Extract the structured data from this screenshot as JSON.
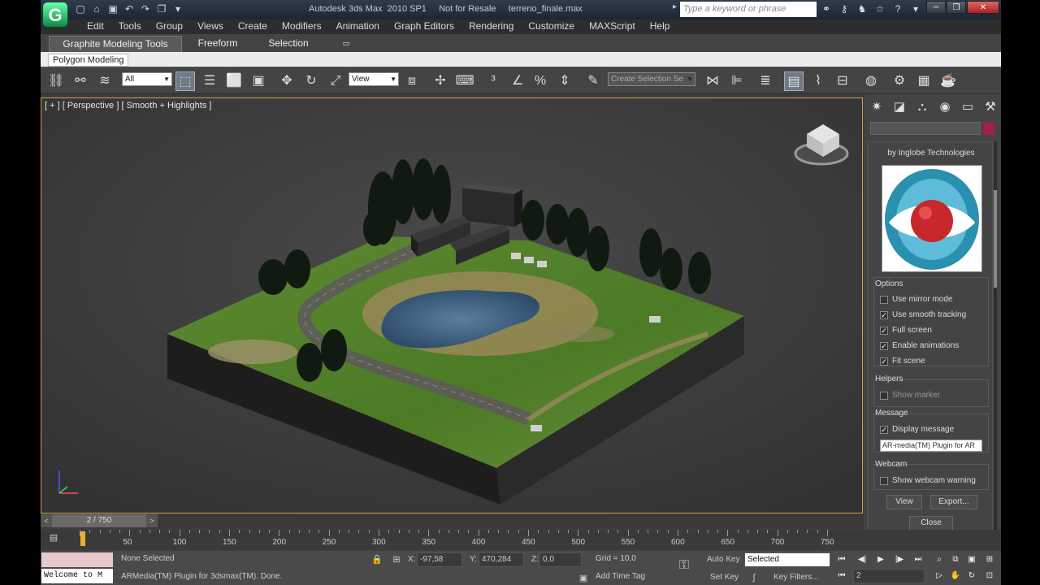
{
  "app": {
    "title": "Autodesk 3ds Max  2010 SP1     Not for Resale     terreno_finale.max",
    "logo": "3ds-max-logo",
    "search_placeholder": "Type a keyword or phrase"
  },
  "menu": [
    "Edit",
    "Tools",
    "Group",
    "Views",
    "Create",
    "Modifiers",
    "Animation",
    "Graph Editors",
    "Rendering",
    "Customize",
    "MAXScript",
    "Help"
  ],
  "ribbon": {
    "tabs": [
      "Graphite Modeling Tools",
      "Freeform",
      "Selection"
    ],
    "panel": "Polygon Modeling"
  },
  "toolbar": {
    "selection_filter": "All",
    "ref_coord": "View",
    "named_selection": "Create Selection Se"
  },
  "viewport": {
    "label": "[ + ] [ Perspective ] [ Smooth + Highlights ]"
  },
  "plugin": {
    "by": "by Inglobe Technologies",
    "options_title": "Options",
    "options": [
      {
        "label": "Use mirror mode",
        "checked": false
      },
      {
        "label": "Use smooth tracking",
        "checked": true
      },
      {
        "label": "Full screen",
        "checked": true
      },
      {
        "label": "Enable animations",
        "checked": true
      },
      {
        "label": "Fit scene",
        "checked": true
      }
    ],
    "helpers_title": "Helpers",
    "helpers": [
      {
        "label": "Show marker",
        "checked": false
      }
    ],
    "message_title": "Message",
    "message": [
      {
        "label": "Display message",
        "checked": true
      }
    ],
    "message_text": "AR-media(TM) Plugin for AR",
    "webcam_title": "Webcam",
    "webcam": [
      {
        "label": "Show webcam warning",
        "checked": false
      }
    ],
    "view_button": "View",
    "export_button": "Export...",
    "close_button": "Close"
  },
  "timeline": {
    "frame": "2 / 750",
    "ticks": [
      "50",
      "100",
      "150",
      "200",
      "250",
      "300",
      "350",
      "400",
      "450",
      "500",
      "550",
      "600",
      "650",
      "700",
      "750"
    ],
    "current_frame_fraction": 0.0027
  },
  "status": {
    "maxscript": "Welcome to M",
    "selection": "None Selected",
    "prompt": "ARMedia(TM) Plugin for 3dsmax(TM). Done.",
    "x_label": "X:",
    "x_value": "-97,58",
    "y_label": "Y:",
    "y_value": "470,284",
    "z_label": "Z:",
    "z_value": "0,0",
    "grid": "Grid = 10,0",
    "add_time_tag": "Add Time Tag",
    "auto_key": "Auto Key",
    "key_mode": "Selected",
    "set_key": "Set Key",
    "key_filters": "Key Filters...",
    "current_frame": "2"
  },
  "colors": {
    "accent_viewport_border": "#cfa34a",
    "object_color": "#a0204a"
  }
}
